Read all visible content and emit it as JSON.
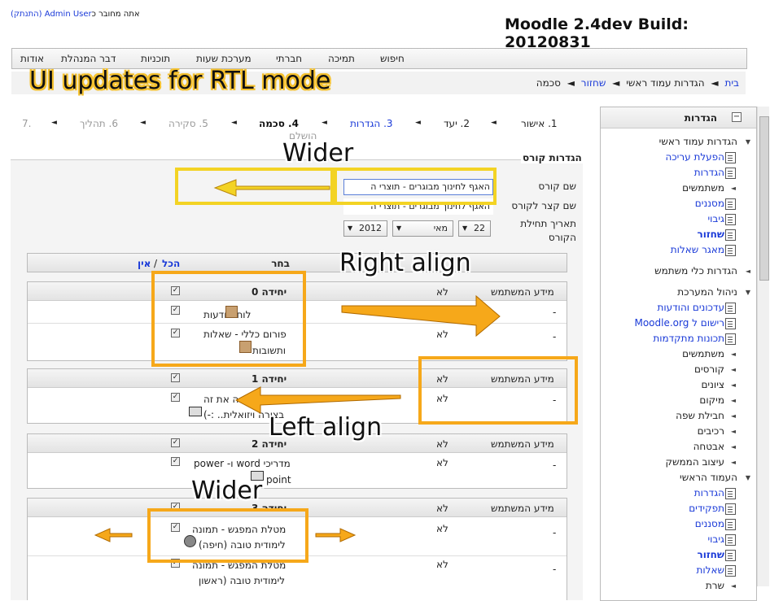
{
  "header": {
    "login_prefix": "אתה מחובר כ",
    "login_user": "Admin User",
    "login_logout": "(התנתק)",
    "site_title": "Moodle 2.4dev Build: 20120831"
  },
  "topnav": {
    "items": [
      "אודות",
      "דבר המנהלת",
      "תוכניות",
      "מערכת שעות",
      "חברתי",
      "תמיכה",
      "חיפוש"
    ]
  },
  "breadcrumb": {
    "items": [
      "בית",
      "הגדרות עמוד ראשי",
      "שחזור",
      "סכמה"
    ],
    "sep": "◄"
  },
  "stepper": {
    "steps": [
      "1. אישור",
      "2. יעד",
      "3. הגדרות",
      "4. סכמה",
      "5. סקירה",
      "6. תהליך",
      "7."
    ],
    "step7_sub": "הושלם"
  },
  "course_settings": {
    "legend": "הגדרות קורס",
    "course_name_label": "שם קורס",
    "course_name_value": "האגף לחינוך מבוגרים - תוצרי ה",
    "short_name_label": "שם קצר לקורס",
    "short_name_value": "האגף לחינוך מבוגרים - תוצרי ה",
    "start_date_label_1": "תאריך תחילת",
    "start_date_label_2": "הקורס",
    "day": "22",
    "month": "מאי",
    "year": "2012"
  },
  "select_bar": {
    "choose": "בחר",
    "all": "הכל",
    "sep": "/",
    "none": "אין"
  },
  "sections": [
    {
      "title": "יחידה 0",
      "userinfo_label": "מידע המשתמש",
      "userinfo_value": "לא",
      "rows": [
        {
          "line1": "לוח מודעות",
          "line2": "",
          "value": "לא",
          "dash": "-"
        },
        {
          "line1": "פורום כללי - שאלות",
          "line2": "ותשובות",
          "value": "לא",
          "dash": "-"
        }
      ]
    },
    {
      "title": "יחידה 1",
      "userinfo_label": "מידע המשתמש",
      "userinfo_value": "לא",
      "rows": [
        {
          "line1": "ה את זה",
          "line2": "בצורה ויזואלית.. :-)",
          "value": "לא",
          "dash": "-"
        }
      ]
    },
    {
      "title": "יחידה 2",
      "userinfo_label": "מידע המשתמש",
      "userinfo_value": "לא",
      "rows": [
        {
          "line1": "מדריכי word ו- power",
          "line2": "point",
          "value": "לא",
          "dash": "-"
        }
      ]
    },
    {
      "title": "יחידה 3",
      "userinfo_label": "מידע המשתמש",
      "userinfo_value": "לא",
      "rows": [
        {
          "line1": "מטלת המפגש - תמונה",
          "line2": "לימודית טובה (חיפה)",
          "value": "לא",
          "dash": "-"
        },
        {
          "line1": "מטלת המפגש - תמונה",
          "line2": "לימודית טובה (ראשון",
          "value": "לא",
          "dash": "-"
        }
      ]
    }
  ],
  "sidebar": {
    "title": "הגדרות",
    "items": [
      {
        "label": "הגדרות עמוד ראשי",
        "kind": "expanded"
      },
      {
        "label": "הפעלת עריכה",
        "kind": "link"
      },
      {
        "label": "הגדרות",
        "kind": "link"
      },
      {
        "label": "משתמשים",
        "kind": "collapsed"
      },
      {
        "label": "מסננים",
        "kind": "link"
      },
      {
        "label": "גיבוי",
        "kind": "link"
      },
      {
        "label": "שחזור",
        "kind": "current"
      },
      {
        "label": "מאגר שאלות",
        "kind": "link"
      },
      {
        "label": "הגדרות כלי משתמש",
        "kind": "collapsed"
      },
      {
        "label": "ניהול המערכת",
        "kind": "expanded"
      },
      {
        "label": "עדכונים והודעות",
        "kind": "link"
      },
      {
        "label": "רישום ל Moodle.org",
        "kind": "link"
      },
      {
        "label": "תכונות מתקדמות",
        "kind": "link"
      },
      {
        "label": "משתמשים",
        "kind": "collapsed"
      },
      {
        "label": "קורסים",
        "kind": "collapsed"
      },
      {
        "label": "ציונים",
        "kind": "collapsed"
      },
      {
        "label": "מיקום",
        "kind": "collapsed"
      },
      {
        "label": "חבילת שפה",
        "kind": "collapsed"
      },
      {
        "label": "רכיבים",
        "kind": "collapsed"
      },
      {
        "label": "אבטחה",
        "kind": "collapsed"
      },
      {
        "label": "עיצוב הממשק",
        "kind": "collapsed"
      },
      {
        "label": "העמוד הראשי",
        "kind": "expanded"
      },
      {
        "label": "הגדרות",
        "kind": "link"
      },
      {
        "label": "תפקידים",
        "kind": "link"
      },
      {
        "label": "מסננים",
        "kind": "link"
      },
      {
        "label": "גיבוי",
        "kind": "link"
      },
      {
        "label": "שחזור",
        "kind": "current"
      },
      {
        "label": "שאלות",
        "kind": "link"
      },
      {
        "label": "שרת",
        "kind": "collapsed"
      }
    ]
  },
  "annotations": {
    "rtl_title": "UI updates for RTL mode",
    "wider_1": "Wider",
    "right_align": "Right align",
    "left_align": "Left align",
    "wider_2": "Wider"
  },
  "colors": {
    "link": "#1a3ad8",
    "annotation_orange": "#f6a81a",
    "annotation_yellow": "#f3d324"
  }
}
